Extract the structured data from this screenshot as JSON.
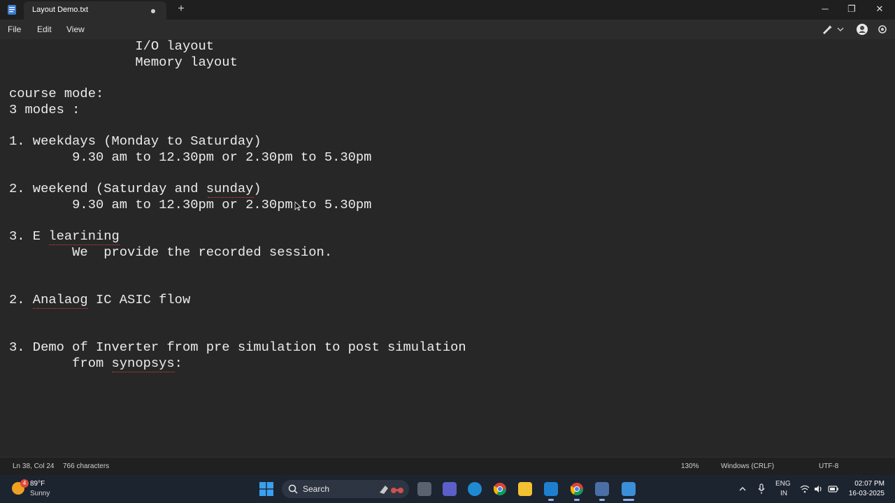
{
  "window": {
    "tab_title": "Layout Demo.txt",
    "new_tab_label": "+",
    "minimize_label": "─",
    "maximize_label": "❐",
    "close_label": "✕"
  },
  "menu": {
    "file": "File",
    "edit": "Edit",
    "view": "View"
  },
  "editor": {
    "lines": [
      "                I/O layout",
      "                Memory layout",
      "",
      "course mode:",
      "3 modes :",
      "",
      "1. weekdays (Monday to Saturday)",
      "        9.30 am to 12.30pm or 2.30pm to 5.30pm",
      "",
      "2. weekend (Saturday and sunday)",
      "        9.30 am to 12.30pm or 2.30pm to 5.30pm",
      "",
      "3. E learining",
      "        We  provide the recorded session.",
      "",
      "",
      "2. Analaog IC ASIC flow",
      "",
      "",
      "3. Demo of Inverter from pre simulation to post simulation",
      "        from synopsys:"
    ]
  },
  "status": {
    "position": "Ln 38, Col 24",
    "characters": "766 characters",
    "zoom": "130%",
    "line_ending": "Windows (CRLF)",
    "encoding": "UTF-8"
  },
  "taskbar": {
    "weather_badge": "4",
    "temperature": "89°F",
    "condition": "Sunny",
    "search_label": "Search",
    "language_line1": "ENG",
    "language_line2": "IN",
    "time": "02:07 PM",
    "date": "16-03-2025"
  },
  "colors": {
    "editor_bg": "#272727",
    "title_bg": "#1f1f1f",
    "taskbar_bg": "#1c2430",
    "spell_error": "#e04040"
  }
}
